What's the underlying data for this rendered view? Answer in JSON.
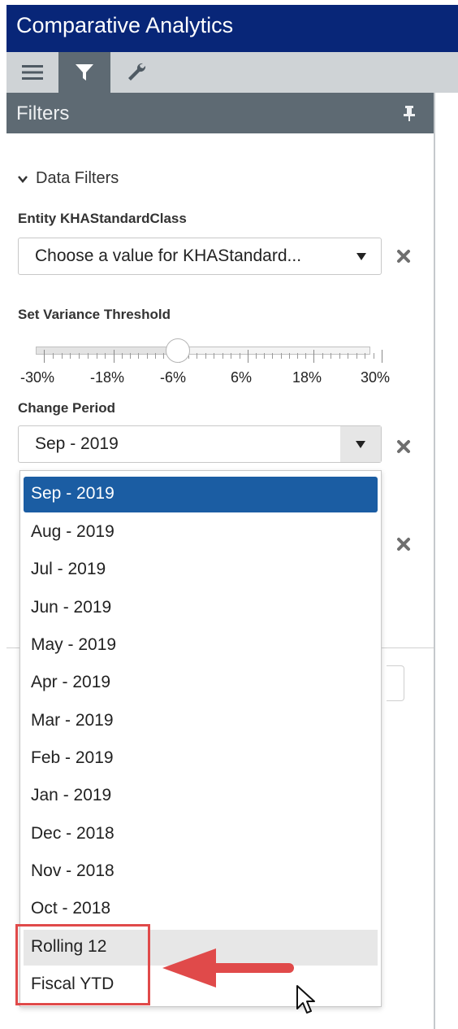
{
  "app": {
    "title": "Comparative Analytics"
  },
  "toolbar": {
    "tabs": [
      {
        "name": "menu",
        "icon": "hamburger-icon"
      },
      {
        "name": "filters",
        "icon": "filter-icon",
        "active": true
      },
      {
        "name": "tools",
        "icon": "wrench-icon"
      }
    ]
  },
  "panel": {
    "title": "Filters",
    "pin_icon": "pin-icon"
  },
  "data_filters": {
    "heading": "Data Filters",
    "entity_label": "Entity KHAStandardClass",
    "entity_value": "Choose a value for KHAStandard...",
    "variance_label": "Set Variance Threshold",
    "variance_ticks": [
      "-30%",
      "-18%",
      "-6%",
      "6%",
      "18%",
      "30%"
    ],
    "variance_value": "-6%",
    "change_period_label": "Change Period",
    "change_period_value": "Sep - 2019"
  },
  "dropdown": {
    "options": [
      "Sep - 2019",
      "Aug - 2019",
      "Jul - 2019",
      "Jun - 2019",
      "May - 2019",
      "Apr - 2019",
      "Mar - 2019",
      "Feb - 2019",
      "Jan - 2019",
      "Dec - 2018",
      "Nov - 2018",
      "Oct - 2018",
      "Rolling 12",
      "Fiscal YTD"
    ],
    "selected": "Sep - 2019",
    "hovered": "Rolling 12"
  },
  "colors": {
    "title_bar": "#082678",
    "panel_header": "#5e6a73",
    "selected_option": "#1b5da3",
    "annotation_red": "#e04a4a"
  }
}
